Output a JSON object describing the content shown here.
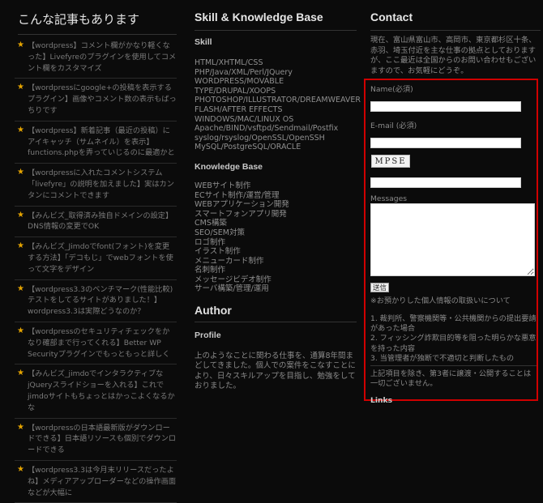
{
  "left": {
    "title": "こんな記事もあります",
    "articles": [
      "【wordpress】コメント欄がかなり軽くなった】Livefyreのプラグインを使用してコメント欄をカスタマイズ",
      "【wordpressにgoogle+の投稿を表示するプラグイン】画像やコメント数の表示もばっちりです",
      "【wordpress】新着記事（最近の投稿）にアイキャッチ（サムネイル）を表示】functions.phpを弄っていじるのに最適かと",
      "【wordpressに入れたコメントシステム「livefyre」の説明を加えました】実はカンタンにコメントできます",
      "【みんビズ_取得済み独自ドメインの設定】DNS情報の変更でOK",
      "【みんビズ_Jimdoでfont(フォント)を変更する方法】「デコもじ」でwebフォントを使って文字をデザイン",
      "【wordpress3.3のベンチマーク(性能比較)テストをしてるサイトがありました！】wordpress3.3は実際どうなのか？",
      "【wordpressのセキュリティチェックをかなり確部まで行ってくれる】Better WP Securityプラグインでもっともっと詳しく",
      "【みんビズ_jimdoでインタラクティブなjQueryスライドショーを入れる】これでjimdoサイトもちょっとはかっこよくなるかな",
      "【wordpressの日本語最新版がダウンロードできる】日本語リソースも個別でダウンロードできる",
      "【wordpress3.3は今月末リリースだったよね】メディアアップローダーなどの操作画面などが大幅に"
    ]
  },
  "mid": {
    "title": "Skill & Knowledge Base",
    "skill_heading": "Skill",
    "skills": [
      "HTML/XHTML/CSS",
      "PHP/Java/XML/Perl/JQuery",
      "WORDPRESS/MOVABLE",
      "TYPE/DRUPAL/XOOPS",
      "PHOTOSHOP/ILLUSTRATOR/DREAMWEAVER",
      "FLASH/AFTER EFFECTS",
      "WINDOWS/MAC/LINUX OS",
      "Apache/BIND/vsftpd/Sendmail/Postfix",
      "syslog/rsyslog/OpenSSL/OpenSSH",
      "MySQL/PostgreSQL/ORACLE"
    ],
    "kb_heading": "Knowledge Base",
    "kb": [
      "WEBサイト制作",
      "ECサイト制作/運営/管理",
      "WEBアプリケーション開発",
      "スマートフォンアプリ開発",
      "CMS構築",
      "SEO/SEM対策",
      "ロゴ制作",
      "イラスト制作",
      "メニューカード制作",
      "名刺制作",
      "メッセージビデオ制作",
      "サーバ構築/管理/運用"
    ],
    "author_title": "Author",
    "profile_heading": "Profile",
    "profile_text": "上のようなことに関わる仕事を、通算8年間まどしてきました。個人での案件をこなすことにより、日々スキルアップを目指し、勉強をしておりました。"
  },
  "right": {
    "title": "Contact",
    "intro": "現在、富山県富山市、高岡市、東京都杉区十条、赤羽、埼玉付近を主な仕事の拠点としておりますが、ここ最近は全国からのお問い合わせもございますので、お気軽にどうぞ。",
    "name_label": "Name(必須)",
    "email_label": "E-mail (必須)",
    "captcha_text": "MPSE",
    "messages_label": "Messages",
    "submit_label": "送信",
    "privacy_title": "※お預かりした個人情報の取扱いについて",
    "privacy_items": [
      "1. 裁判所、警察機関等・公共機関からの提出要請があった場合",
      "2. フィッシング詐欺目的等を阻った明らかな悪意を持った内容",
      "3. 当管理者が独断で不適切と判断したもの"
    ],
    "privacy_note": "上記項目を除き、第3者に譲渡・公開することは一切ございません。",
    "bottom_label": "Links"
  }
}
